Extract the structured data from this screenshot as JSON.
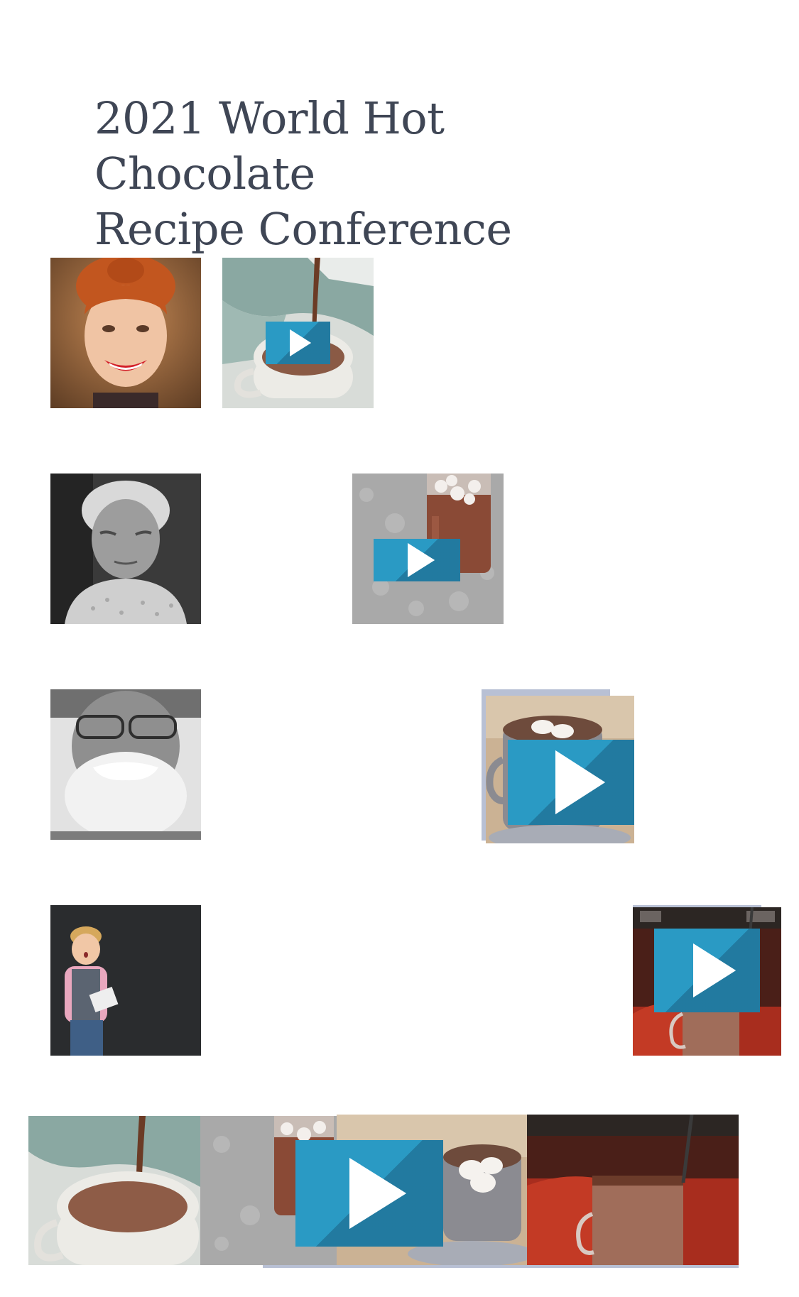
{
  "page": {
    "title_line1": "2021 World Hot Chocolate",
    "title_line2": "Recipe Conference"
  },
  "colors": {
    "title": "#3f4655",
    "play_button": "#2a9ac4",
    "frame": "#b8c0d4"
  },
  "speakers": [
    {
      "name": "speaker-red-haired-woman"
    },
    {
      "name": "speaker-elderly-woman"
    },
    {
      "name": "speaker-bearded-man"
    },
    {
      "name": "speaker-young-boy"
    }
  ],
  "videos": [
    {
      "name": "video-pouring-cocoa",
      "icon": "play-icon"
    },
    {
      "name": "video-marshmallow-jar",
      "icon": "play-icon"
    },
    {
      "name": "video-marshmallow-mug",
      "icon": "play-icon"
    },
    {
      "name": "video-cafe-cocoa",
      "icon": "play-icon"
    }
  ],
  "carousel": {
    "icon": "play-icon"
  }
}
